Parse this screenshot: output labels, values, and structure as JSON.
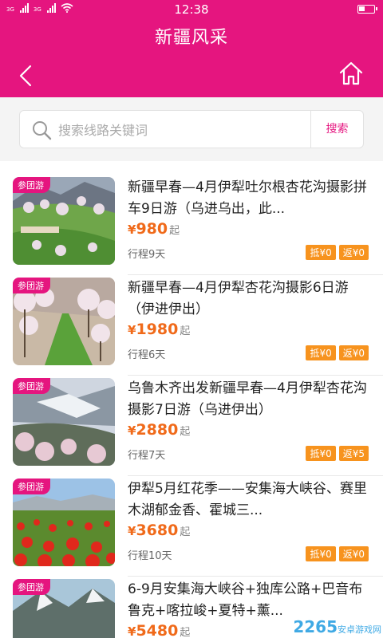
{
  "status_bar": {
    "time": "12:38",
    "network_1": "3G",
    "network_2": "3G",
    "icons": [
      "signal-icon",
      "signal-icon",
      "wifi-icon",
      "battery-icon"
    ]
  },
  "header": {
    "title": "新疆风采",
    "back_icon": "back-arrow-icon",
    "home_icon": "home-icon",
    "color": "#e5157f"
  },
  "search": {
    "placeholder": "搜索线路关键词",
    "button_label": "搜索"
  },
  "colors": {
    "accent": "#e5157f",
    "price": "#f06a1a",
    "badge": "#f7931e"
  },
  "tours": [
    {
      "tag": "参团游",
      "name": "新疆早春—4月伊犁吐尔根杏花沟摄影拼车9日游（乌进乌出，此...",
      "currency": "¥",
      "price": "980",
      "price_suffix": "起",
      "duration": "行程9天",
      "badges": [
        "抵¥0",
        "返¥0"
      ]
    },
    {
      "tag": "参团游",
      "name": "新疆早春—4月伊犁杏花沟摄影6日游（伊进伊出）",
      "currency": "¥",
      "price": "1980",
      "price_suffix": "起",
      "duration": "行程6天",
      "badges": [
        "抵¥0",
        "返¥0"
      ]
    },
    {
      "tag": "参团游",
      "name": "乌鲁木齐出发新疆早春—4月伊犁杏花沟摄影7日游（乌进伊出）",
      "currency": "¥",
      "price": "2880",
      "price_suffix": "起",
      "duration": "行程7天",
      "badges": [
        "抵¥0",
        "返¥5"
      ]
    },
    {
      "tag": "参团游",
      "name": "伊犁5月红花季——安集海大峡谷、赛里木湖郁金香、霍城三...",
      "currency": "¥",
      "price": "3680",
      "price_suffix": "起",
      "duration": "行程10天",
      "badges": [
        "抵¥0",
        "返¥0"
      ]
    },
    {
      "tag": "参团游",
      "name": "6-9月安集海大峡谷+独库公路+巴音布鲁克+喀拉峻+夏特+薰...",
      "currency": "¥",
      "price": "5480",
      "price_suffix": "起",
      "duration": "",
      "badges": []
    }
  ],
  "watermark": {
    "text": "2265",
    "sub": "安卓游戏网"
  }
}
